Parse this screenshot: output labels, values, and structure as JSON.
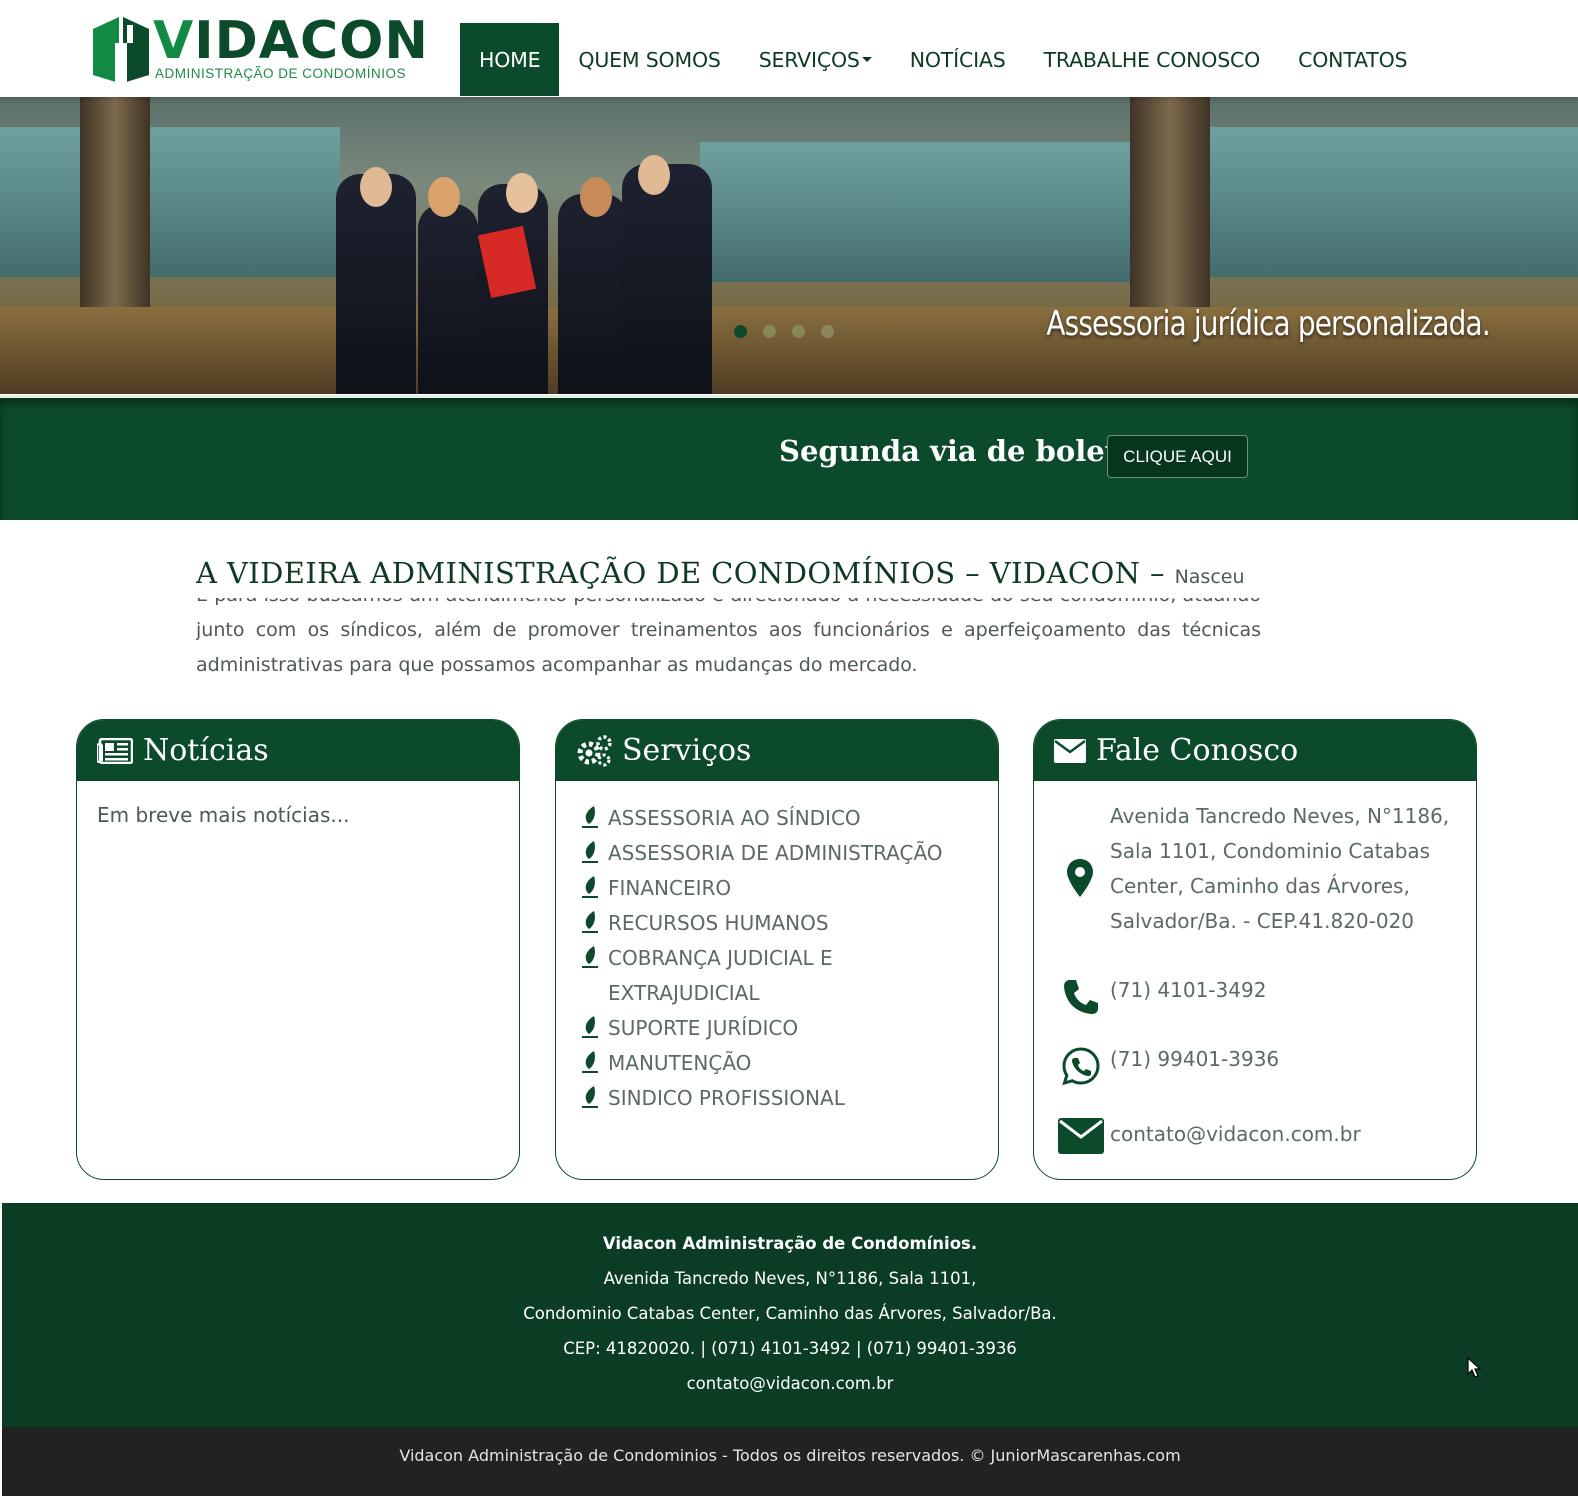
{
  "brand": {
    "name_first": "V",
    "name_rest": "IDACON",
    "tagline": "ADMINISTRAÇÃO DE CONDOMÍNIOS",
    "primary_color": "#0b4a2a",
    "accent_color": "#128a44"
  },
  "nav": {
    "items": [
      {
        "label": "HOME",
        "active": true
      },
      {
        "label": "QUEM SOMOS",
        "active": false
      },
      {
        "label": "SERVIÇOS",
        "active": false,
        "dropdown": true
      },
      {
        "label": "NOTÍCIAS",
        "active": false
      },
      {
        "label": "TRABALHE CONOSCO",
        "active": false
      },
      {
        "label": "CONTATOS",
        "active": false
      }
    ]
  },
  "hero": {
    "caption": "Assessoria jurídica personalizada.",
    "slides": 4,
    "active_slide": 1
  },
  "boleto": {
    "text": "Segunda via de boleto",
    "button_label": "CLIQUE AQUI"
  },
  "about": {
    "title": "A VIDEIRA ADMINISTRAÇÃO DE CONDOMÍNIOS – VIDACON –",
    "lead": "Nasceu",
    "text": "E para isso buscamos um atendimento personalizado e direcionado à necessidade do seu condomínio, atuando junto com os síndicos, além de promover treinamentos aos funcionários e aperfeiçoamento das técnicas administrativas para que possamos acompanhar as mudanças do mercado."
  },
  "cards": {
    "news": {
      "title": "Notícias",
      "icon": "newspaper-icon",
      "body": "Em breve mais notícias..."
    },
    "services": {
      "title": "Serviços",
      "icon": "gears-icon",
      "items": [
        "ASSESSORIA AO SÍNDICO",
        "ASSESSORIA DE ADMINISTRAÇÃO",
        "FINANCEIRO",
        "RECURSOS HUMANOS",
        "COBRANÇA JUDICIAL E EXTRAJUDICIAL",
        "SUPORTE JURÍDICO",
        "MANUTENÇÃO",
        "SINDICO PROFISSIONAL"
      ]
    },
    "contact": {
      "title": "Fale Conosco",
      "icon": "envelope-icon",
      "address": "Avenida Tancredo Neves, N°1186, Sala 1101, Condominio Catabas Center, Caminho das Árvores, Salvador/Ba. - CEP.41.820-020",
      "phone": "(71) 4101-3492",
      "whatsapp": "(71) 99401-3936",
      "email": "contato@vidacon.com.br"
    }
  },
  "footer": {
    "company": "Vidacon Administração de Condomínios.",
    "address_line1": "Avenida Tancredo Neves, N°1186, Sala 1101,",
    "address_line2": "Condominio Catabas Center, Caminho das Árvores, Salvador/Ba.",
    "contact_line": "CEP: 41820020. | (071) 4101-3492 | (071) 99401-3936",
    "email": "contato@vidacon.com.br",
    "copyright": "Vidacon Administração de Condominios - Todos os direitos reservados. © JuniorMascarenhas.com"
  }
}
